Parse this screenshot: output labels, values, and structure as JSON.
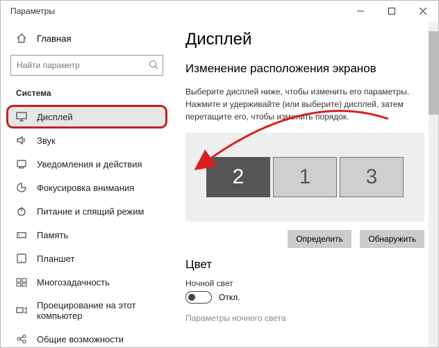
{
  "window": {
    "title": "Параметры"
  },
  "sidebar": {
    "home_label": "Главная",
    "search_placeholder": "Найти параметр",
    "section_title": "Система",
    "items": [
      {
        "label": "Дисплей"
      },
      {
        "label": "Звук"
      },
      {
        "label": "Уведомления и действия"
      },
      {
        "label": "Фокусировка внимания"
      },
      {
        "label": "Питание и спящий режим"
      },
      {
        "label": "Память"
      },
      {
        "label": "Планшет"
      },
      {
        "label": "Многозадачность"
      },
      {
        "label": "Проецирование на этот компьютер"
      },
      {
        "label": "Общие возможности"
      }
    ]
  },
  "main": {
    "title": "Дисплей",
    "subtitle": "Изменение расположения экранов",
    "description": "Выберите дисплей ниже, чтобы изменить его параметры. Нажмите и удерживайте (или выберите) дисплей, затем перетащите его, чтобы изменить порядок.",
    "displays": [
      {
        "num": "2",
        "active": true
      },
      {
        "num": "1",
        "active": false
      },
      {
        "num": "3",
        "active": false
      }
    ],
    "identify_btn": "Определить",
    "detect_btn": "Обнаружить",
    "color_head": "Цвет",
    "night_label": "Ночной свет",
    "night_state": "Откл.",
    "night_params": "Параметры ночного света"
  }
}
